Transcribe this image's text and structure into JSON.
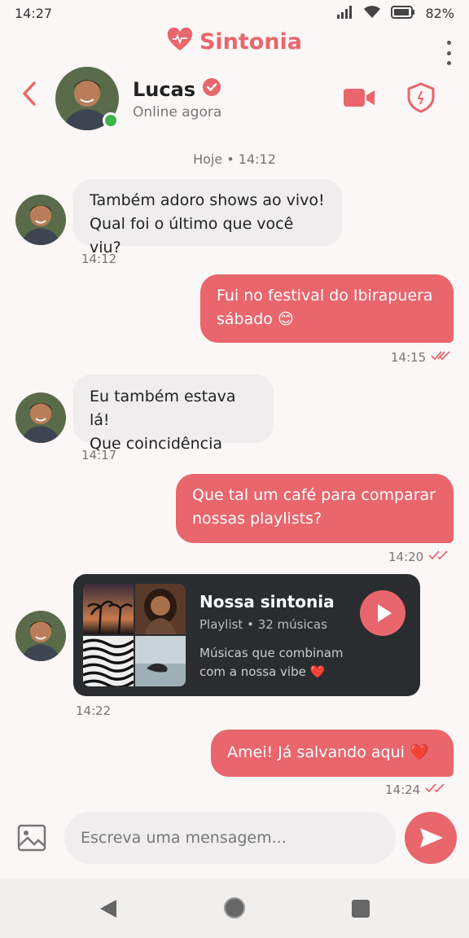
{
  "status_bar": {
    "time": "14:27",
    "battery": "82%"
  },
  "app": {
    "title": "Sintonia",
    "accent_color": "#e8666c"
  },
  "contact": {
    "name": "Lucas",
    "status": "Online agora"
  },
  "chat": {
    "date_separator": "Hoje • 14:12",
    "messages": [
      {
        "direction": "in",
        "lines": [
          "Também adoro shows ao vivo!",
          "Qual foi o último que você viu?"
        ],
        "time": "14:12"
      },
      {
        "direction": "out",
        "lines": [
          "Fui no festival do Ibirapuera",
          "sábado 😊"
        ],
        "time": "14:15"
      },
      {
        "direction": "in",
        "lines": [
          "Eu também estava lá!",
          "Que coincidência"
        ],
        "time": "14:17"
      },
      {
        "direction": "out",
        "lines": [
          "Que tal um café para comparar",
          "nossas playlists?"
        ],
        "time": "14:20"
      },
      {
        "direction": "out",
        "lines": [
          "Amei! Já salvando aqui ❤️"
        ],
        "time": "14:24"
      }
    ],
    "playlist": {
      "title": "Nossa sintonia",
      "subtitle": "Playlist • 32 músicas",
      "description_lines": [
        "Músicas que combinam",
        "com a nossa vibe ❤️"
      ],
      "time": "14:22"
    }
  },
  "composer": {
    "placeholder": "Escreva uma mensagem..."
  }
}
